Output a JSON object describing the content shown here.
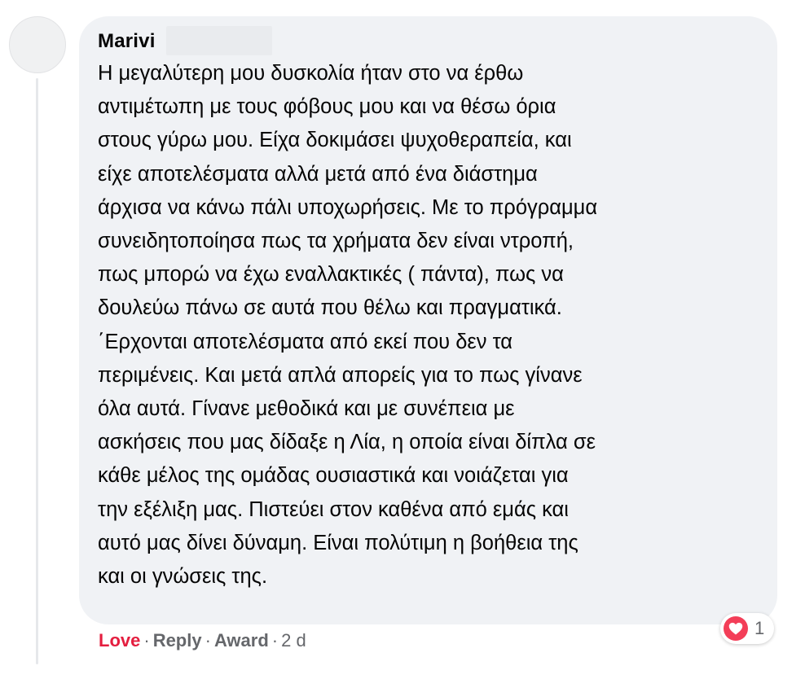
{
  "comment": {
    "author": "Marivi",
    "lines": [
      "Η μεγαλύτερη μου δυσκολία ήταν στο να έρθω",
      "αντιμέτωπη με τους φόβους μου και να θέσω όρια",
      "στους γύρω μου. Είχα δοκιμάσει ψυχοθεραπεία, και",
      "είχε αποτελέσματα αλλά μετά από ένα διάστημα",
      "άρχισα να κάνω πάλι υποχωρήσεις. Με το πρόγραμμα",
      "συνειδητοποίησα πως τα χρήματα δεν είναι ντροπή,",
      "πως μπορώ να έχω εναλλακτικές ( πάντα), πως να",
      "δουλεύω πάνω σε αυτά που θέλω και πραγματικά.",
      "΄Ερχονται αποτελέσματα από εκεί που δεν τα",
      "περιμένεις. Και μετά απλά απορείς για το πως γίνανε",
      "όλα αυτά. Γίνανε μεθοδικά και με συνέπεια με",
      "ασκήσεις που μας δίδαξε η Λία, η οποία είναι δίπλα σε",
      "κάθε μέλος της ομάδας ουσιαστικά και νοιάζεται για",
      "την εξέλιξη μας. Πιστεύει στον καθένα από εμάς και",
      "αυτό μας δίνει δύναμη. Είναι πολύτιμη η βοήθεια της",
      "και οι γνώσεις της."
    ]
  },
  "actions": {
    "love": "Love",
    "reply": "Reply",
    "award": "Award",
    "separator": "·",
    "time": "2 d"
  },
  "reactions": {
    "icon": "heart-icon",
    "color": "#f33e58",
    "count": "1"
  },
  "colors": {
    "bubble": "#f0f2f5",
    "love_active": "#e41e3f",
    "meta_text": "#65676b"
  }
}
